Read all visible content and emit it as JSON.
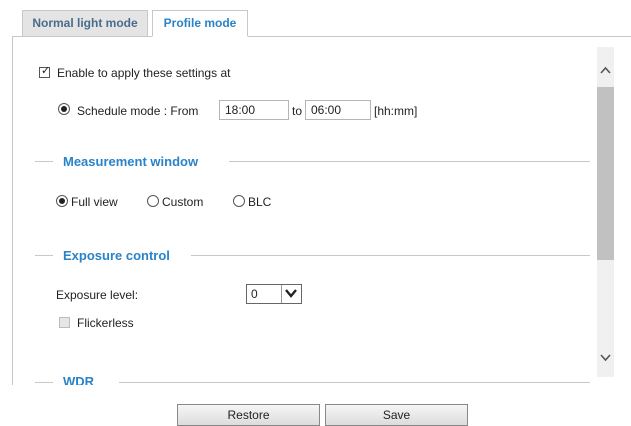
{
  "tabs": [
    {
      "label": "Normal light mode",
      "active": false
    },
    {
      "label": "Profile mode",
      "active": true
    }
  ],
  "enable": {
    "label": "Enable to apply these settings at",
    "checked": true
  },
  "schedule": {
    "label": "Schedule mode : From",
    "from_value": "18:00",
    "to_label": "to",
    "to_value": "06:00",
    "format_label": "[hh:mm]",
    "selected": true
  },
  "measurement": {
    "title": "Measurement window",
    "options": [
      "Full view",
      "Custom",
      "BLC"
    ],
    "selected": "Full view"
  },
  "exposure": {
    "title": "Exposure control",
    "level_label": "Exposure level:",
    "level_value": "0",
    "flickerless_label": "Flickerless",
    "flickerless_checked": false
  },
  "wdr": {
    "title": "WDR"
  },
  "footer": {
    "restore_label": "Restore",
    "save_label": "Save"
  },
  "icons": {
    "check": "check-icon",
    "scroll_up": "chevron-up-icon",
    "scroll_down": "chevron-down-icon",
    "dropdown": "chevron-down-icon"
  },
  "colors": {
    "accent": "#2a83c9",
    "tab_inactive_bg": "#e4e4e4",
    "border": "#c8c8c8"
  }
}
